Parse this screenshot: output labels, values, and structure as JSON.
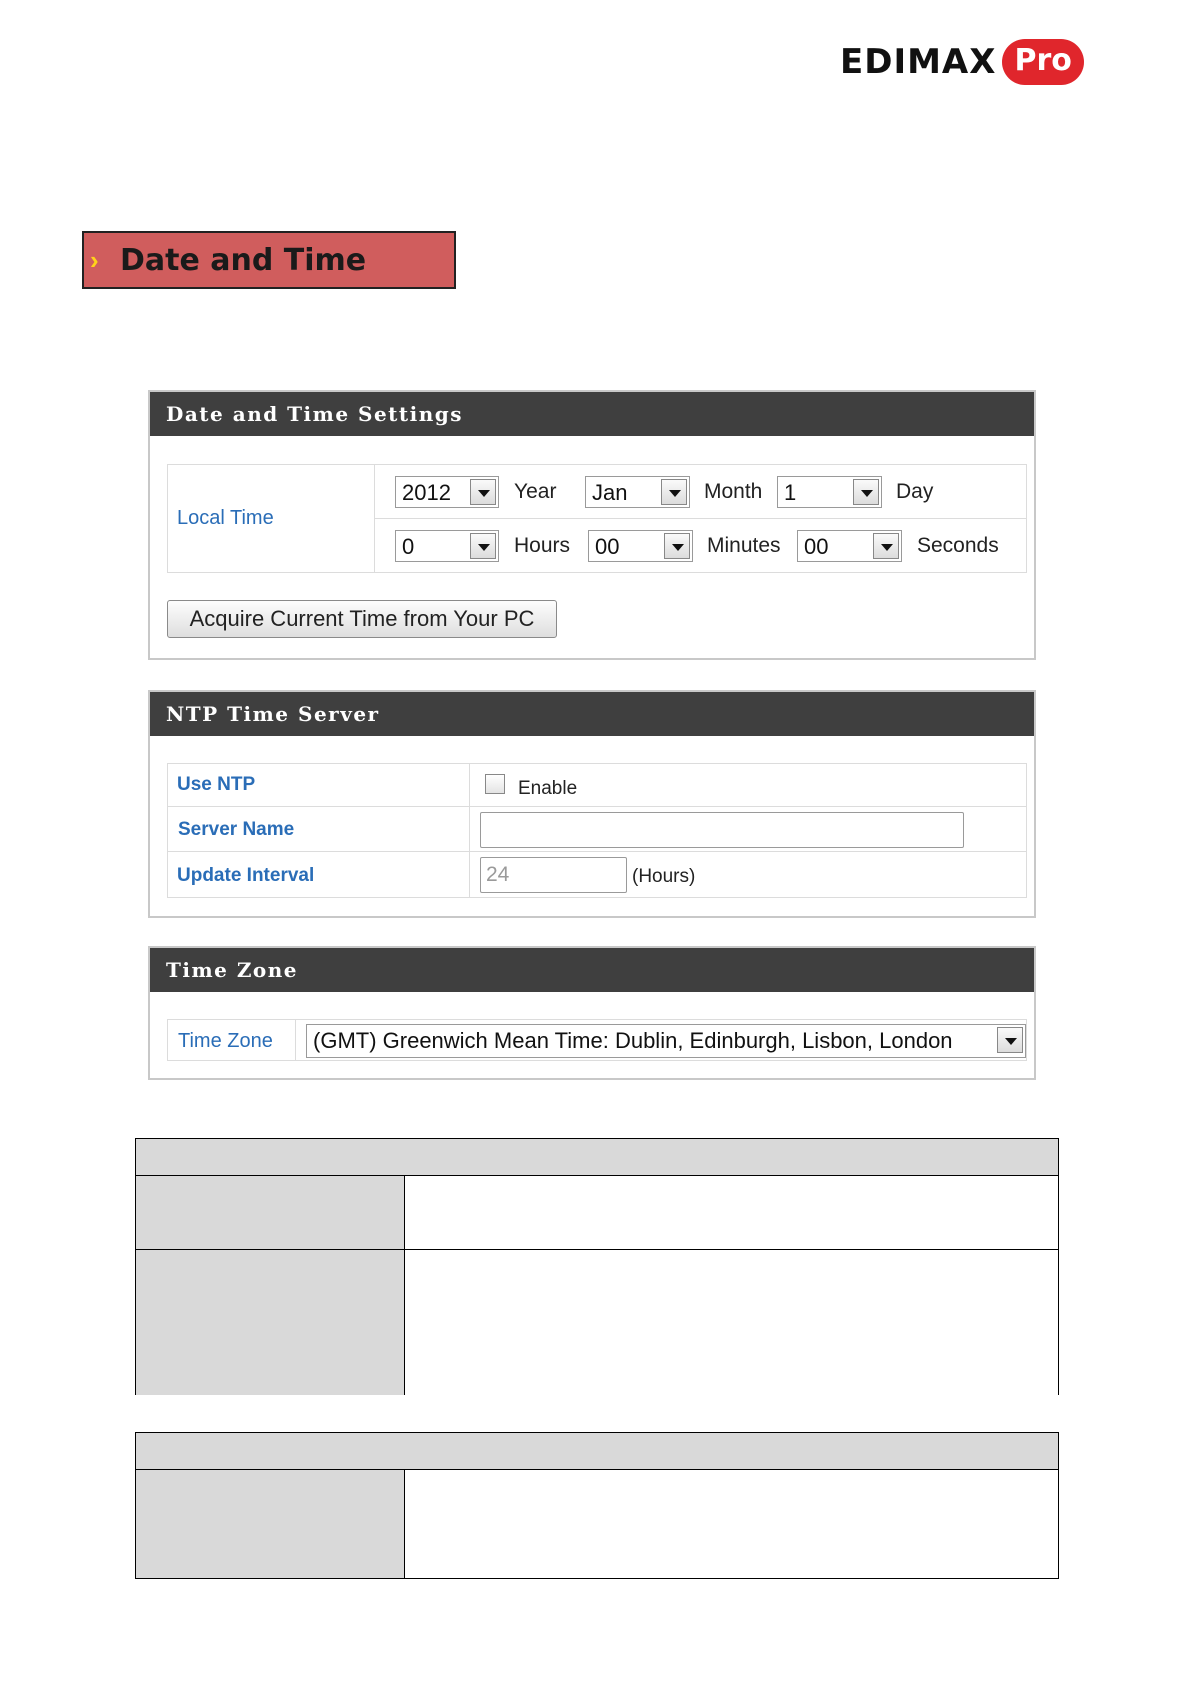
{
  "brand": {
    "word": "EDIMAX",
    "pro": "Pro"
  },
  "section_title": "Date and Time",
  "date_time_settings": {
    "header": "Date and Time Settings",
    "local_time_label": "Local Time",
    "year": "2012",
    "year_unit": "Year",
    "month": "Jan",
    "month_unit": "Month",
    "day": "1",
    "day_unit": "Day",
    "hours": "0",
    "hours_unit": "Hours",
    "minutes": "00",
    "minutes_unit": "Minutes",
    "seconds": "00",
    "seconds_unit": "Seconds",
    "acquire_button": "Acquire Current Time from Your PC"
  },
  "ntp": {
    "header": "NTP Time Server",
    "use_ntp_label": "Use NTP",
    "enable_label": "Enable",
    "enabled": false,
    "server_name_label": "Server Name",
    "server_name_value": "",
    "update_interval_label": "Update Interval",
    "update_interval_value": "24",
    "update_interval_unit": "(Hours)"
  },
  "time_zone": {
    "header": "Time Zone",
    "label": "Time Zone",
    "value": "(GMT) Greenwich Mean Time: Dublin, Edinburgh, Lisbon, London"
  }
}
